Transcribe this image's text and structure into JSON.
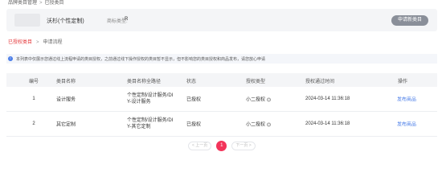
{
  "breadcrumb": {
    "items": [
      "品牌类目管理",
      "已授类目"
    ],
    "separator": ">"
  },
  "header": {
    "store_name": "沃杉(个性定制)",
    "brand_type_label": "商标类型:",
    "brand_type_value": "R",
    "apply_button_label": "申请新类目"
  },
  "tabs": {
    "authorized": "已授权类目",
    "flow": "申请流程",
    "separator": ">"
  },
  "notice": {
    "icon": "info-icon",
    "text": "本列表中仅展示您通过线上流程申请的类目授权，之前通过线下操作授权的类目暂不显示，但不影响您的类目授权和商品发布，请您放心申请"
  },
  "table": {
    "columns": [
      "编号",
      "类目名称",
      "类目名称全路径",
      "状态",
      "授权类型",
      "授权通过时间",
      "操作"
    ],
    "rows": [
      {
        "id": "1",
        "name": "设计服务",
        "path_line1": "个性定制/设计服务/DI",
        "path_line2": "Y-设计服务",
        "status": "已授权",
        "auth_type": "小二授权",
        "time": "2024-03-14 11:36:18",
        "action": "发布商品"
      },
      {
        "id": "2",
        "name": "其它定制",
        "path_line1": "个性定制/设计服务/DI",
        "path_line2": "Y-其它定制",
        "status": "已授权",
        "auth_type": "小二授权",
        "time": "2024-03-14 11:36:18",
        "action": "发布商品"
      }
    ]
  },
  "pagination": {
    "prev": "< 上一页",
    "current": "1",
    "next": "下一页 >"
  },
  "colors": {
    "accent": "#f3345a",
    "tab_active": "#e4393c",
    "link": "#4a7de8",
    "button_bg": "#8a8f99"
  }
}
